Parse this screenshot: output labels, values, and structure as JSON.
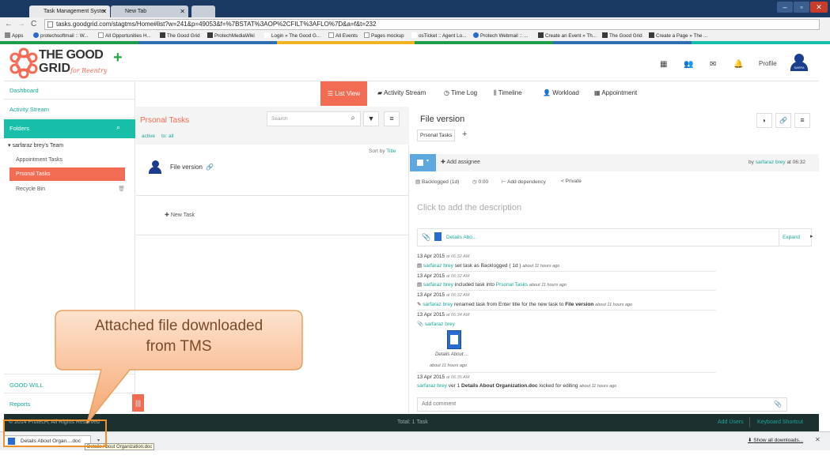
{
  "browser": {
    "tabs": [
      {
        "title": "Task Management Syster",
        "active": true
      },
      {
        "title": "New Tab",
        "active": false
      }
    ],
    "url": "tasks.goodgrid.com/stagtms/Home#list?w=241&p=49053&f=%7BSTAT%3AOP%2CFILT%3AFLO%7D&a=f&t=232",
    "bookmarks": [
      "Apps",
      "protechsoftmail :: W...",
      "All Opportunities H...",
      "The Good Grid",
      "ProtechMediaWiki",
      "Login » The Good G...",
      "All Events",
      "Pages mockup",
      "osTicket :: Agent Lo...",
      "Protech Webmail :: ...",
      "Create an Event » Th...",
      "The Good Grid",
      "Create a Page » The ..."
    ]
  },
  "header": {
    "logo_top": "THE GOOD",
    "logo_bottom": "GRID",
    "logo_tag": "for Reentry",
    "add_icon": "plus-icon",
    "icons": [
      "grid-icon",
      "users-icon",
      "mail-icon",
      "bell-icon"
    ],
    "profile_label": "Profile",
    "avatar_text": "SARFA"
  },
  "sidebar": {
    "dashboard": "Dashboard",
    "activity_stream": "Activity Stream",
    "folders": "Folders",
    "team": "sarfaraz brey's Team",
    "items": [
      {
        "label": "Appointment Tasks",
        "active": false
      },
      {
        "label": "Prsonal Tasks",
        "active": true
      },
      {
        "label": "Recycle Bin",
        "active": false
      }
    ],
    "good_will": "GOOD WILL",
    "reports": "Reports"
  },
  "nav_tabs": {
    "list_view": "List View",
    "activity_stream": "Activity Stream",
    "time_log": "Time Log",
    "timeline": "Timeline",
    "workload": "Workload",
    "appointment": "Appointment"
  },
  "list_panel": {
    "title": "Prsonal Tasks",
    "search_placeholder": "Search",
    "filter_active": "active",
    "filter_to": "to: all",
    "sort_prefix": "Sort by",
    "sort_field": "Title",
    "task_title": "File version",
    "new_task": "New Task"
  },
  "detail_panel": {
    "title": "File version",
    "folder_tag": "Prsonal Tasks",
    "add_assignee": "Add assignee",
    "by_prefix": "by",
    "by_user": "sarfaraz brey",
    "by_time": "at 06:32",
    "status": "Backlogged (1d)",
    "time": "0:00",
    "add_dependency": "Add dependency",
    "private": "Private",
    "description_placeholder": "Click to add the description",
    "attachment_name": "Details Abo...",
    "expand": "Expand",
    "activity": [
      {
        "date": "13 Apr 2015",
        "time": "at 06:32 AM",
        "user": "sarfaraz brey",
        "text": "set task as Backlogged ( 1d )",
        "ago": "about 11 hours ago"
      },
      {
        "date": "13 Apr 2015",
        "time": "at 06:32 AM",
        "user": "sarfaraz brey",
        "text": "included task into",
        "link": "Prsonal Tasks",
        "ago": "about 11 hours ago"
      },
      {
        "date": "13 Apr 2015",
        "time": "at 06:32 AM",
        "user": "sarfaraz brey",
        "text": "renamed task from Enter title for the new task to",
        "bold": "File version",
        "ago": "about 11 hours ago"
      },
      {
        "date": "13 Apr 2015",
        "time": "at 06:34 AM",
        "user": "sarfaraz brey",
        "file_label": "Details About ...",
        "ago": "about 11 hours ago"
      },
      {
        "date": "13 Apr 2015",
        "time": "at 06:35 AM",
        "user": "sarfaraz brey",
        "text": "ver 1",
        "bold": "Details About Organization.doc",
        "text2": "locked for editing",
        "ago": "about 11 hours ago"
      }
    ],
    "add_comment": "Add comment"
  },
  "footer": {
    "copyright": "© 2014 ProtecH, All Rights Reserved",
    "total": "Total: 1 Task",
    "add_users": "Add Users",
    "shortcuts": "Keyboard Shortcut"
  },
  "downloads": {
    "item": "Details About Organ....doc",
    "tooltip": "Details About Organization.doc",
    "show_all": "Show all downloads..."
  },
  "callout": {
    "line1": "Attached file downloaded",
    "line2": "from TMS"
  },
  "colors": {
    "teal": "#17bfa9",
    "orange": "#f26b53",
    "dark_footer": "#1d3030"
  }
}
